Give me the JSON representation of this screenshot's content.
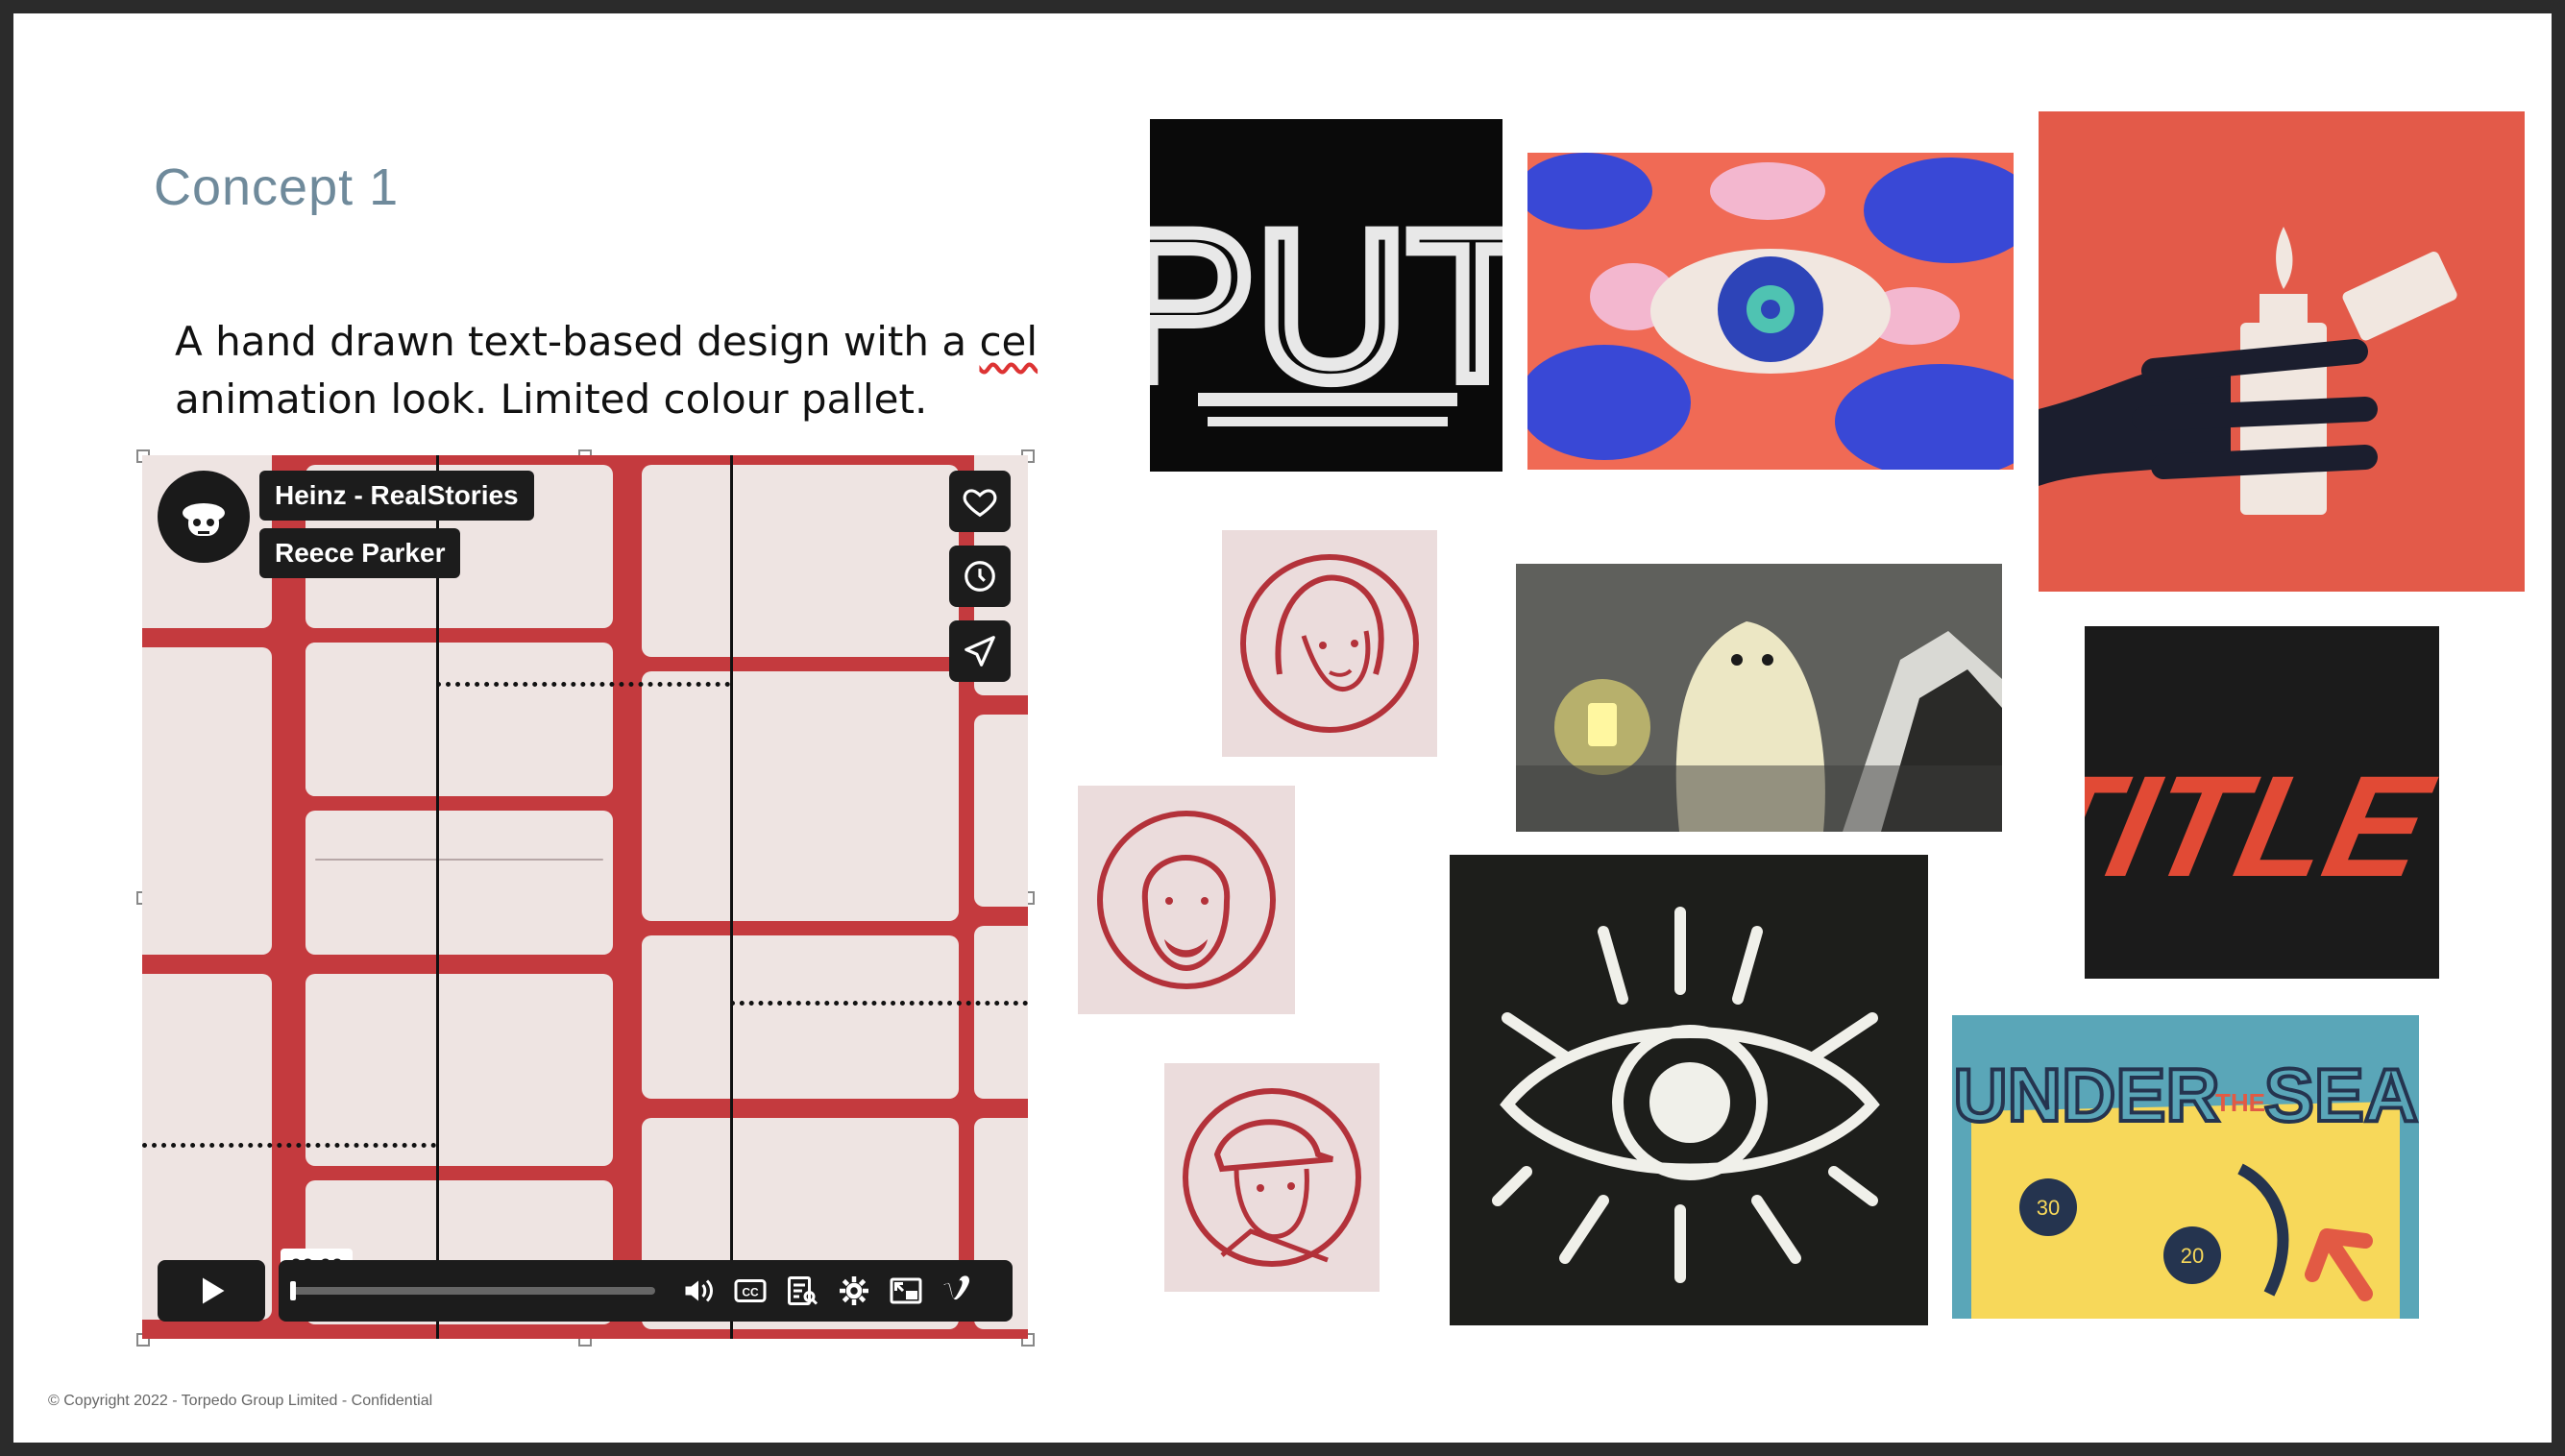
{
  "slide": {
    "title": "Concept 1",
    "description_part1": "A hand drawn text-based design with a ",
    "description_misspelled": "cel",
    "description_part2": " animation look. Limited colour pallet.",
    "copyright": "© Copyright 2022 - Torpedo Group Limited - Confidential"
  },
  "video": {
    "channel_title": "Heinz - RealStories",
    "author": "Reece Parker",
    "timestamp": "00:00",
    "progress": 0,
    "buttons": {
      "like": "heart-icon",
      "watch_later": "clock-icon",
      "share": "paper-plane-icon",
      "play": "play-icon",
      "volume": "volume-icon",
      "captions": "cc-icon",
      "transcript": "transcript-icon",
      "settings": "gear-icon",
      "pip": "picture-in-picture-icon",
      "vimeo": "vimeo-logo-icon"
    },
    "background_color": "#c43a3e"
  },
  "moodboard": {
    "put_letters": "PUT",
    "title_letters": "TITLE",
    "under_sea": {
      "word1": "UNDER",
      "word2": "THE",
      "word3": "SEA",
      "coin1": "30",
      "coin2": "20"
    }
  },
  "colors": {
    "accent_red": "#e05745",
    "portrait_red": "#b3323a",
    "title_blue": "#6f8a9b"
  }
}
